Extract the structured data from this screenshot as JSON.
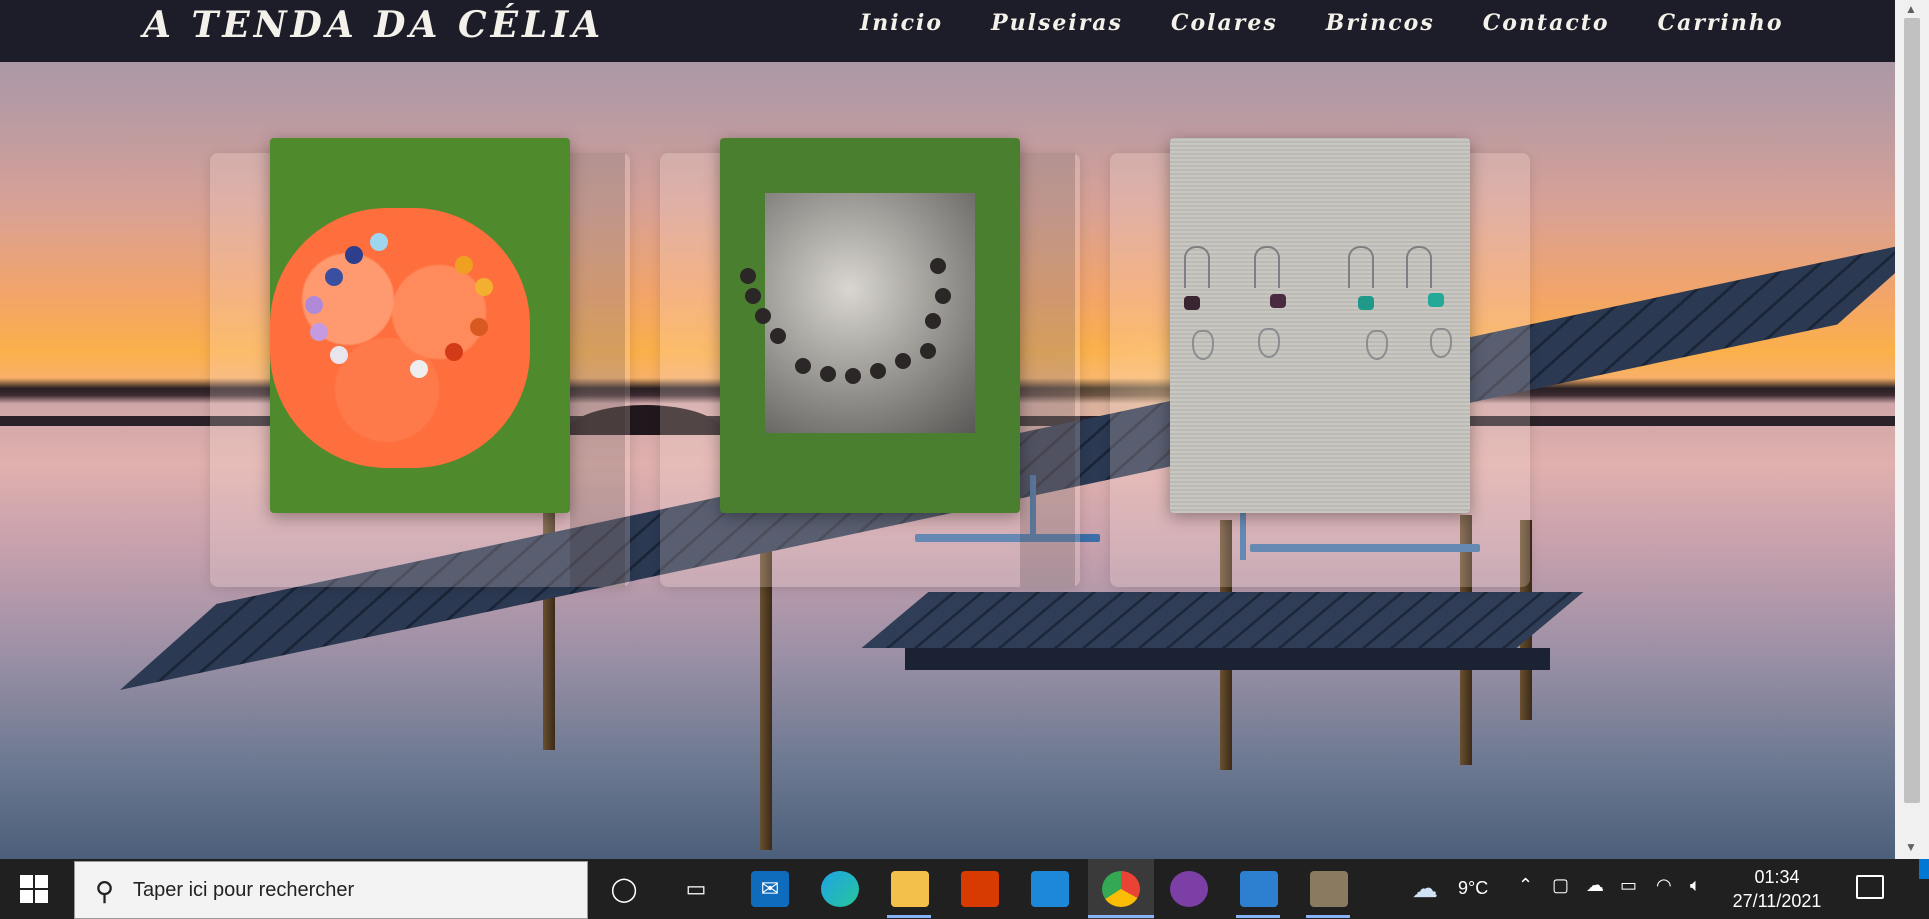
{
  "site": {
    "brand": "A TENDA DA CÉLIA",
    "nav": [
      "Inicio",
      "Pulseiras",
      "Colares",
      "Brincos",
      "Contacto",
      "Carrinho"
    ]
  },
  "taskbar": {
    "search_placeholder": "Taper ici pour rechercher",
    "weather": "9°C",
    "time": "01:34",
    "date": "27/11/2021",
    "apps": [
      "cortana-icon",
      "task-view-icon",
      "mail-icon",
      "edge-icon",
      "file-explorer-icon",
      "office-icon",
      "vscode-icon",
      "chrome-icon",
      "github-desktop-icon",
      "photos-icon",
      "gimp-icon"
    ]
  },
  "colors": {
    "nav_bg": "#1c1d28",
    "nav_text": "#f4f1ea",
    "taskbar_bg": "#202020",
    "accent": "#0078d4"
  }
}
